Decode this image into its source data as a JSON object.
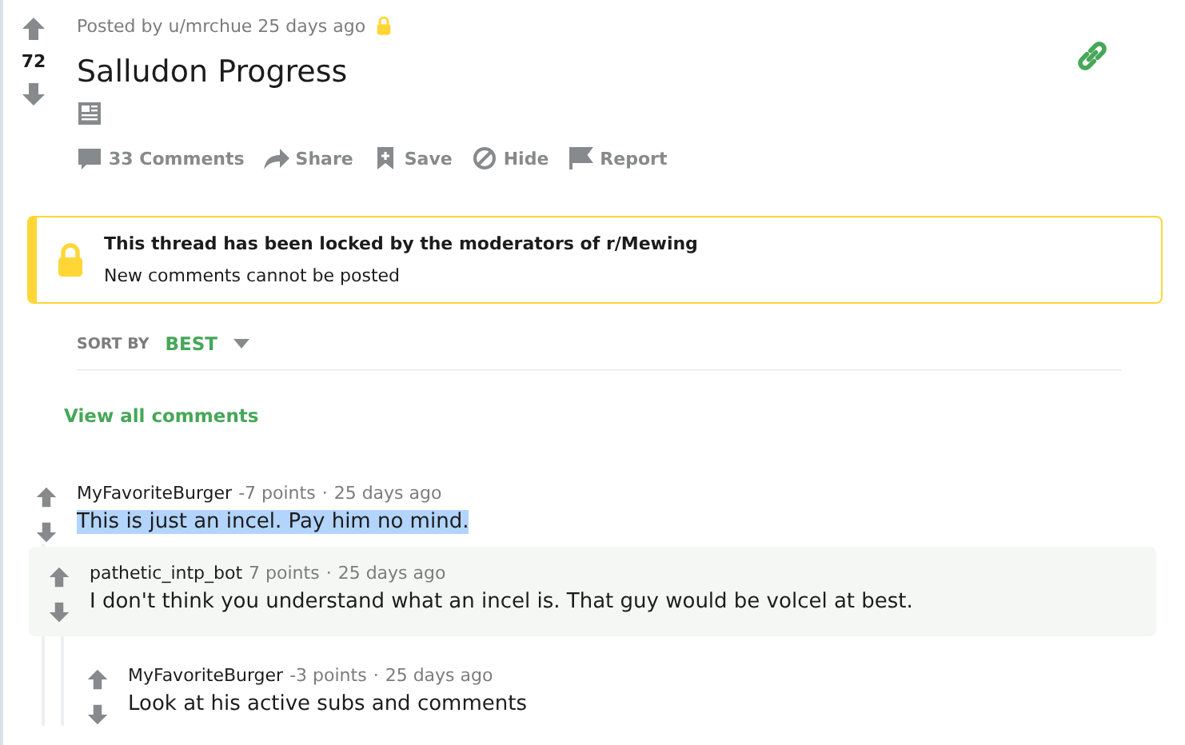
{
  "post": {
    "score": "72",
    "meta": "Posted by u/mrchue 25 days ago",
    "locked": true,
    "title": "Salludon Progress",
    "actions": [
      {
        "kind": "comments",
        "label": "33 Comments"
      },
      {
        "kind": "share",
        "label": "Share"
      },
      {
        "kind": "save",
        "label": "Save"
      },
      {
        "kind": "hide",
        "label": "Hide"
      },
      {
        "kind": "report",
        "label": "Report"
      }
    ]
  },
  "lock_banner": {
    "title": "This thread has been locked by the moderators of r/Mewing",
    "text": "New comments cannot be posted"
  },
  "sort": {
    "label": "SORT BY",
    "value": "BEST"
  },
  "view_all": "View all comments",
  "comments": [
    {
      "author": "MyFavoriteBurger",
      "points": "-7 points",
      "separator": "·",
      "time": "25 days ago",
      "body": "This is just an incel. Pay him no mind.",
      "highlighted": true,
      "children": [
        {
          "author": "pathetic_intp_bot",
          "points": "7 points",
          "separator": "·",
          "time": "25 days ago",
          "body": "I don't think you understand what an incel is. That guy would be volcel at best.",
          "highlighted": false,
          "children": [
            {
              "author": "MyFavoriteBurger",
              "points": "-3 points",
              "separator": "·",
              "time": "25 days ago",
              "body": "Look at his active subs and comments",
              "highlighted": false
            }
          ]
        }
      ]
    }
  ]
}
